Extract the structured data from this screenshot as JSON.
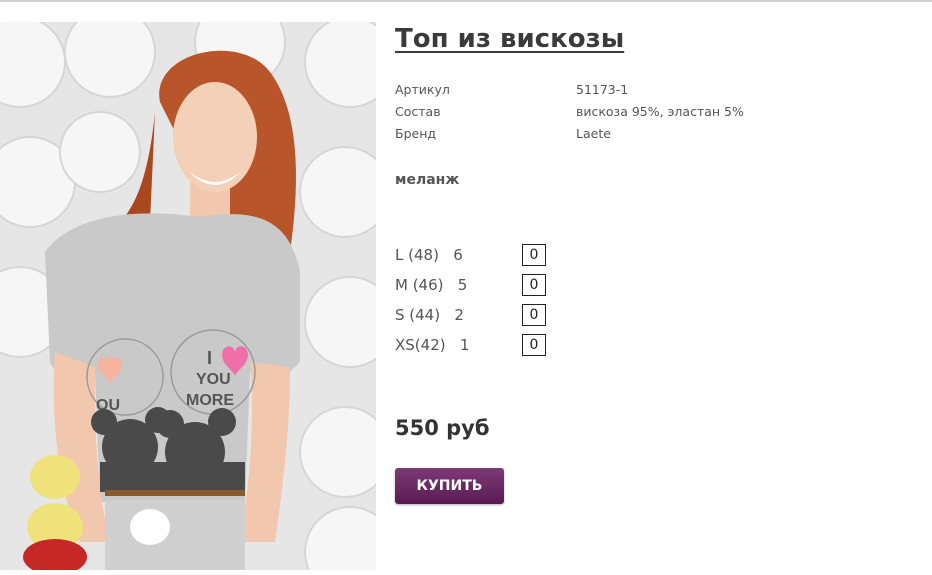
{
  "product": {
    "title": "Топ из вискозы",
    "specs": [
      {
        "label": "Артикул",
        "value": "51173-1"
      },
      {
        "label": "Состав",
        "value": "вискоза 95%, эластан 5%"
      },
      {
        "label": "Бренд",
        "value": "Laete"
      }
    ],
    "color": "меланж",
    "sizes": [
      {
        "label": "L (48)   6",
        "qty": "0"
      },
      {
        "label": "M (46)   5",
        "qty": "0"
      },
      {
        "label": "S (44)   2",
        "qty": "0"
      },
      {
        "label": "XS(42)   1",
        "qty": "0"
      }
    ],
    "price": "550 руб",
    "buy_label": "КУПИТЬ",
    "buy_color": "#6b2a64",
    "shirt_print": {
      "line1": "I",
      "line2": "YOU",
      "line3": "MORE",
      "left_fragment": "OU"
    }
  }
}
